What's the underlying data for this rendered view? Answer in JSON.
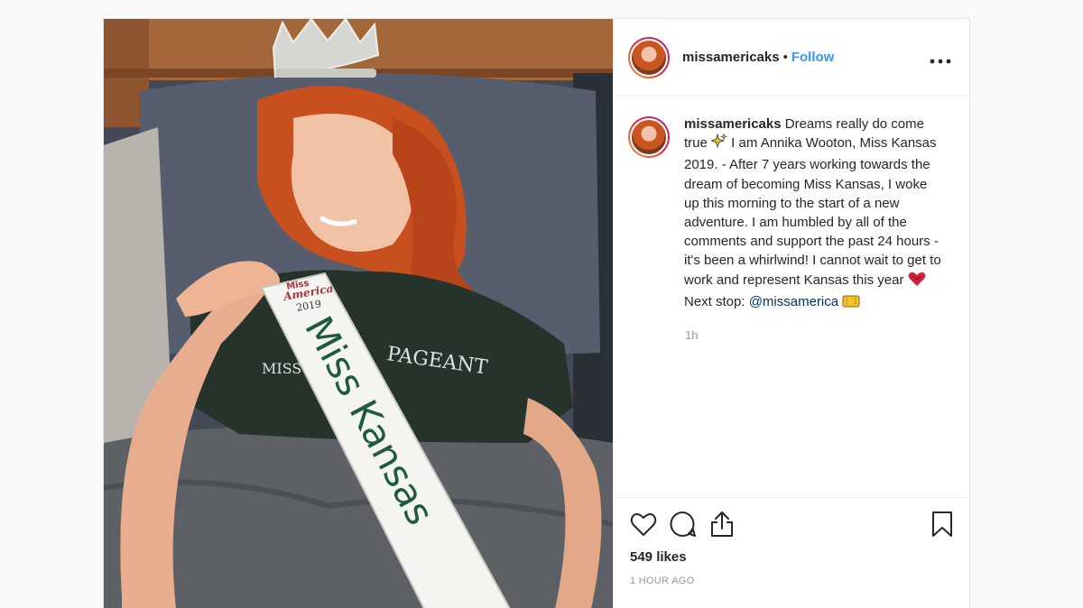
{
  "post": {
    "username": "missamericaks",
    "follow_label": "Follow",
    "separator": "•",
    "more_label": "•••",
    "caption": {
      "username": "missamericaks",
      "part1": " Dreams really do come true ",
      "part2": " I am Annika Wooton, Miss Kansas 2019. - After 7 years working towards the dream of becoming Miss Kansas, I woke up this morning to the start of a new adventure. I am humbled by all of the comments and support the past 24 hours - it's been a whirlwind! I cannot wait to get to work and represent Kansas this year ",
      "part3": "Next stop: ",
      "mention": "@missamerica"
    },
    "caption_time": "1h",
    "likes": "549 likes",
    "posted_time": "1 HOUR AGO"
  },
  "photo": {
    "sash_logo_top": "Miss",
    "sash_logo_main": "America",
    "sash_year": "2019",
    "sash_text": "Miss Kansas",
    "shirt_text": "PAGEANT",
    "shirt_text_left": "MISS",
    "colors": {
      "hair": "#c8501e",
      "shirt": "#25332b",
      "pillow": "#565d6c",
      "blanket": "#5d6166",
      "wood": "#a4673a"
    }
  },
  "icons": {
    "header_more": "more-horizontal-icon",
    "caption_emoji_1": "sparkles-icon",
    "caption_emoji_2": "heart-emoji-icon",
    "caption_emoji_3": "ticket-emoji-icon",
    "like": "heart-outline-icon",
    "comment": "comment-bubble-icon",
    "share": "share-upload-icon",
    "save": "bookmark-icon"
  },
  "colors": {
    "follow": "#3897f0",
    "mention": "#003569",
    "muted": "#999999",
    "text": "#262626"
  }
}
